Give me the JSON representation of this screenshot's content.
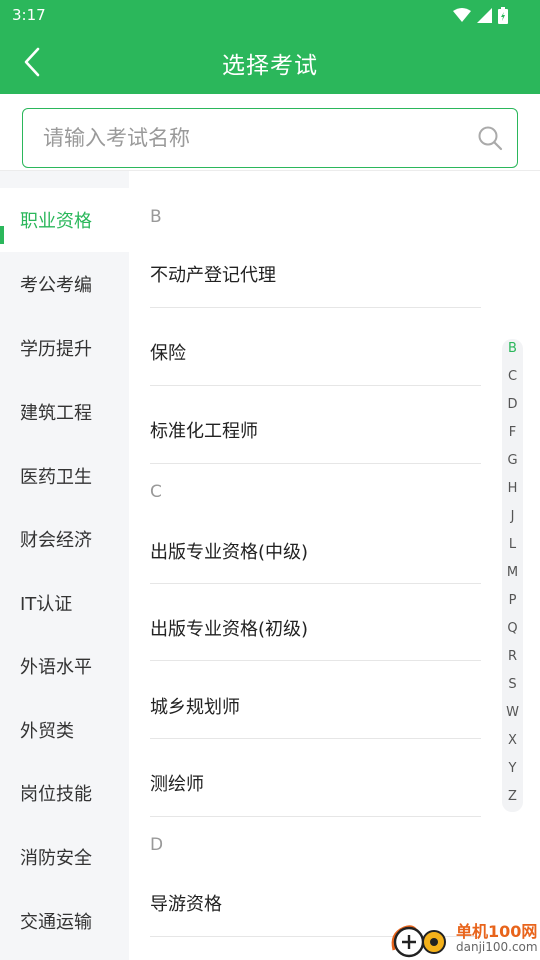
{
  "status_bar": {
    "time": "3:17"
  },
  "app_bar": {
    "title": "选择考试"
  },
  "search": {
    "placeholder": "请输入考试名称"
  },
  "sidebar": {
    "items": [
      {
        "label": "职业资格",
        "active": true
      },
      {
        "label": "考公考编"
      },
      {
        "label": "学历提升"
      },
      {
        "label": "建筑工程"
      },
      {
        "label": "医药卫生"
      },
      {
        "label": "财会经济"
      },
      {
        "label": "IT认证"
      },
      {
        "label": "外语水平"
      },
      {
        "label": "外贸类"
      },
      {
        "label": "岗位技能"
      },
      {
        "label": "消防安全"
      },
      {
        "label": "交通运输"
      }
    ]
  },
  "sections": [
    {
      "letter": "B",
      "items": [
        "不动产登记代理",
        "保险",
        "标准化工程师"
      ]
    },
    {
      "letter": "C",
      "items": [
        "出版专业资格(中级)",
        "出版专业资格(初级)",
        "城乡规划师",
        "测绘师"
      ]
    },
    {
      "letter": "D",
      "items": [
        "导游资格"
      ]
    }
  ],
  "index_bar": {
    "letters": [
      "B",
      "C",
      "D",
      "F",
      "G",
      "H",
      "J",
      "L",
      "M",
      "P",
      "Q",
      "R",
      "S",
      "W",
      "X",
      "Y",
      "Z"
    ],
    "active": "B"
  },
  "watermark": {
    "brand": "单机100网",
    "url": "danji100.com"
  },
  "colors": {
    "accent": "#2bb75b",
    "sidebar_bg": "#f5f6f8"
  }
}
